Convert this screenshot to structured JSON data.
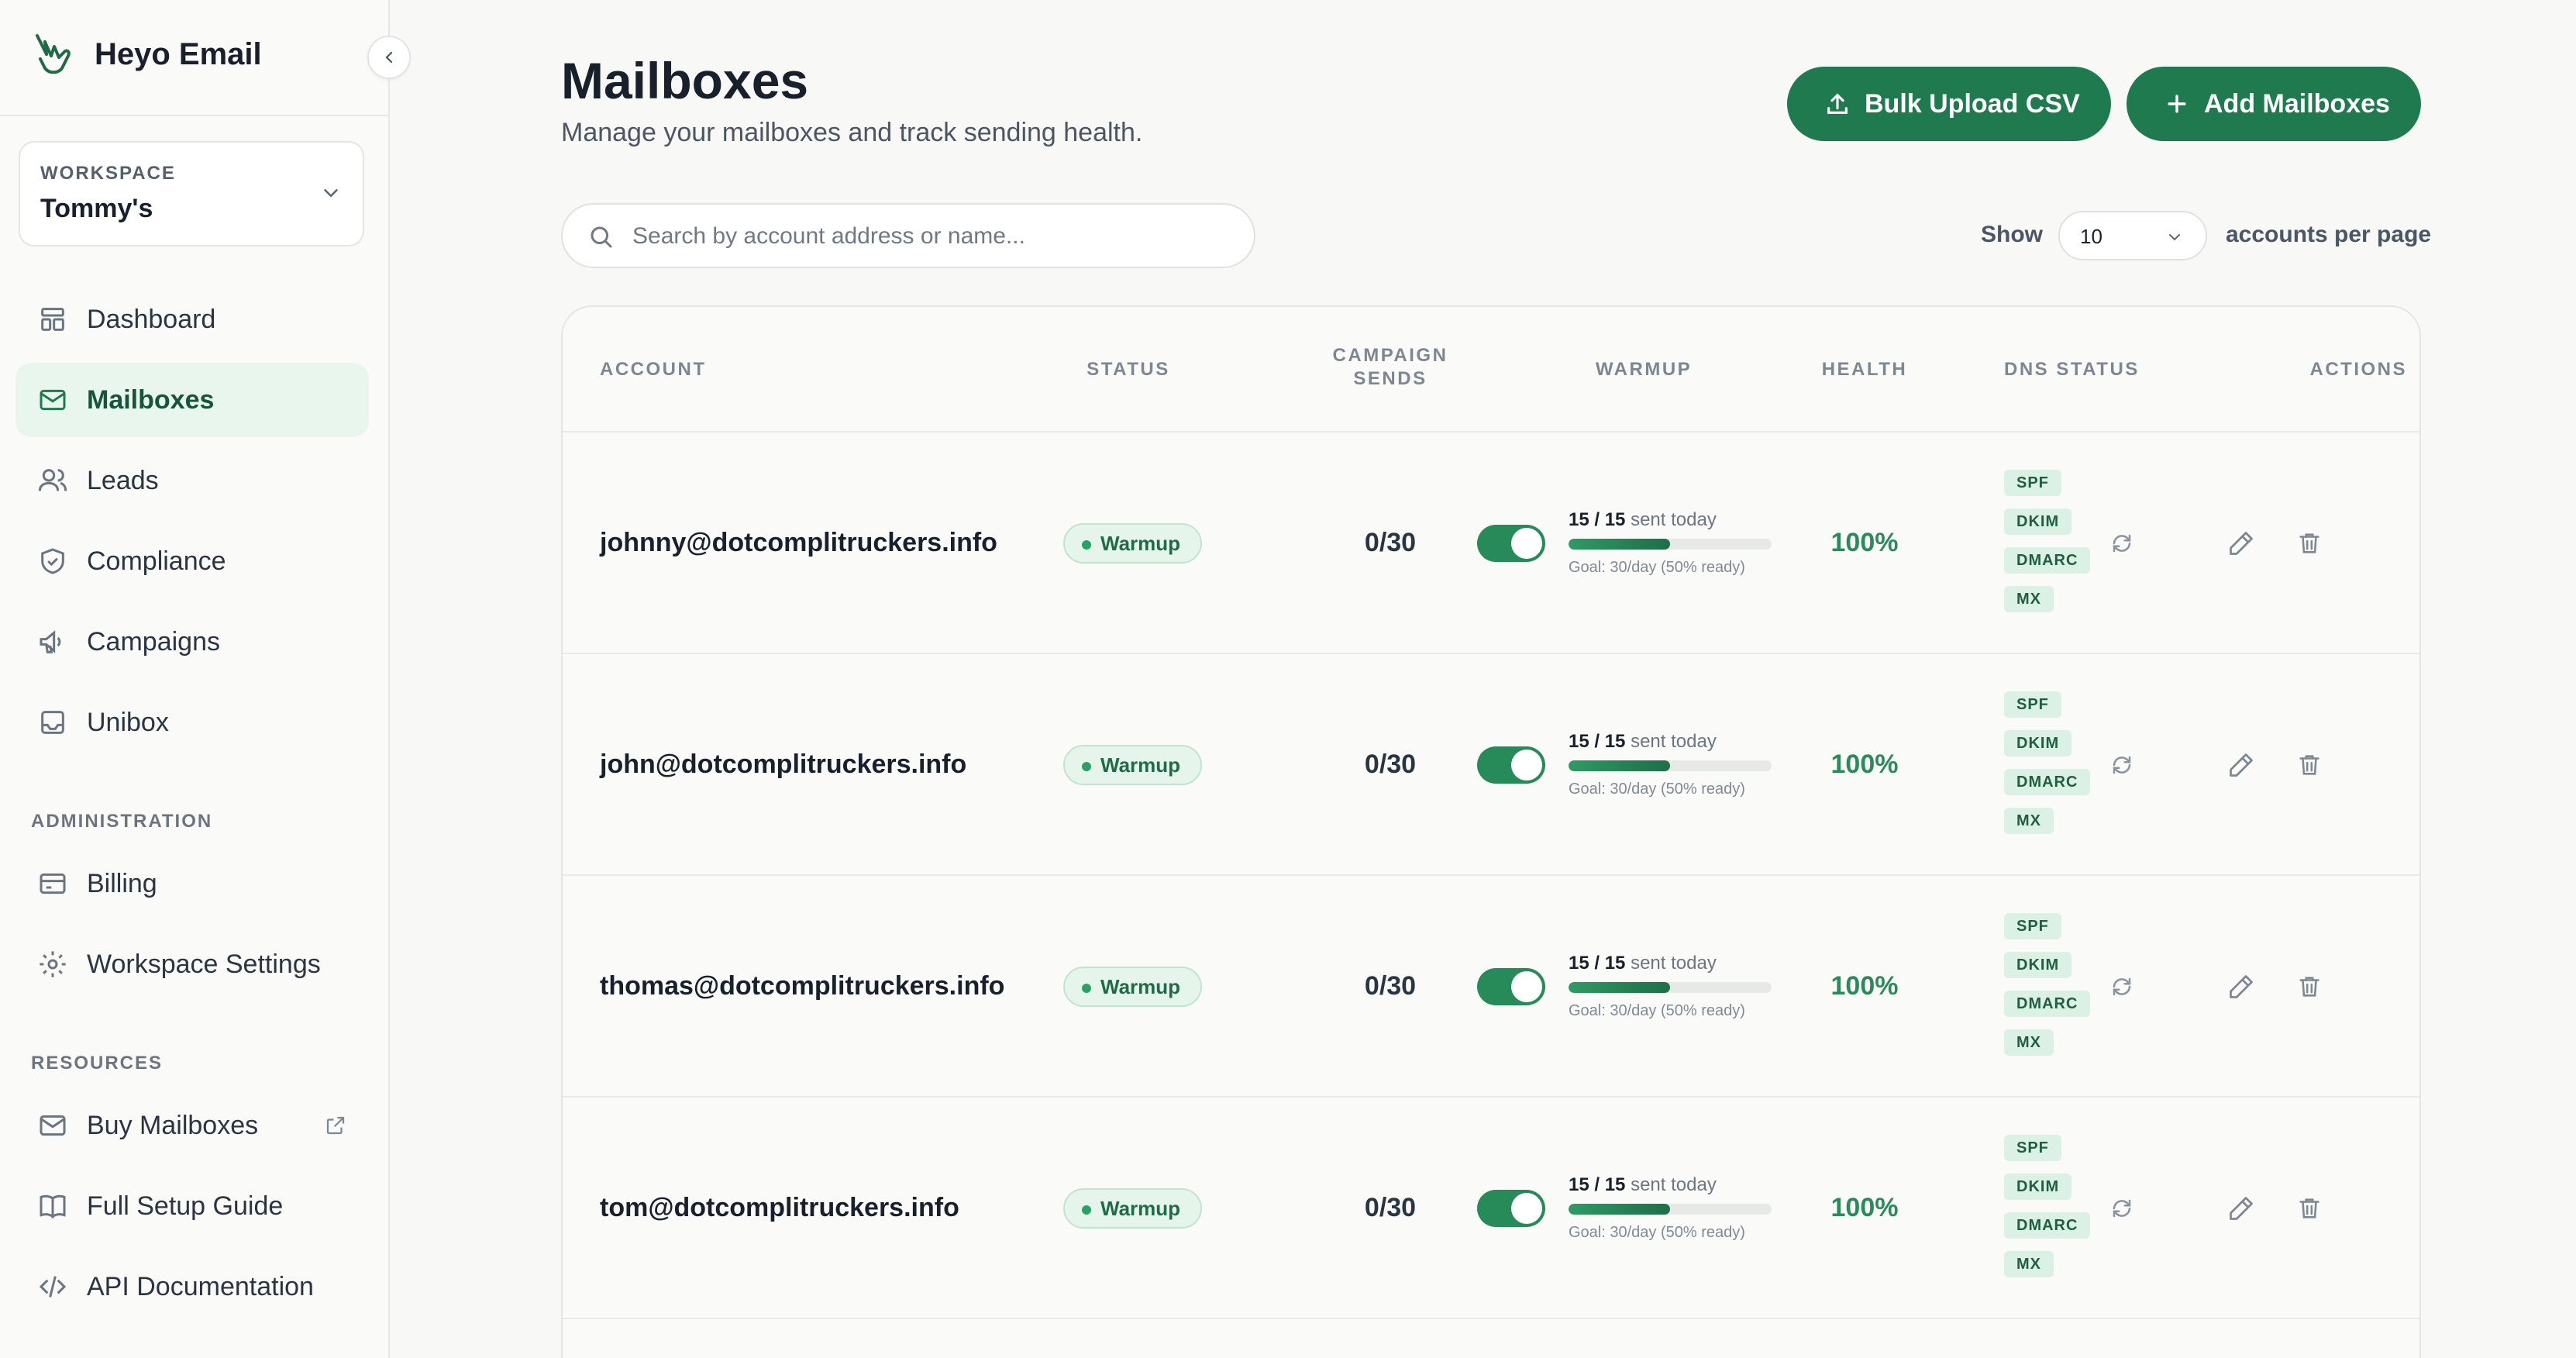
{
  "brand": {
    "name": "Heyo Email"
  },
  "workspace": {
    "label": "WORKSPACE",
    "value": "Tommy's"
  },
  "nav": {
    "main": [
      {
        "label": "Dashboard",
        "icon": "dashboard-icon",
        "active": false
      },
      {
        "label": "Mailboxes",
        "icon": "mail-icon",
        "active": true
      },
      {
        "label": "Leads",
        "icon": "users-icon",
        "active": false
      },
      {
        "label": "Compliance",
        "icon": "shield-check-icon",
        "active": false
      },
      {
        "label": "Campaigns",
        "icon": "megaphone-icon",
        "active": false
      },
      {
        "label": "Unibox",
        "icon": "inbox-icon",
        "active": false
      }
    ],
    "admin_label": "ADMINISTRATION",
    "admin": [
      {
        "label": "Billing",
        "icon": "credit-card-icon"
      },
      {
        "label": "Workspace Settings",
        "icon": "gear-icon"
      }
    ],
    "resources_label": "RESOURCES",
    "resources": [
      {
        "label": "Buy Mailboxes",
        "icon": "mail-icon",
        "external": true
      },
      {
        "label": "Full Setup Guide",
        "icon": "book-icon"
      },
      {
        "label": "API Documentation",
        "icon": "code-icon"
      }
    ]
  },
  "header": {
    "title": "Mailboxes",
    "subtitle": "Manage your mailboxes and track sending health.",
    "bulk_upload_label": "Bulk Upload CSV",
    "add_label": "Add Mailboxes"
  },
  "search": {
    "placeholder": "Search by account address or name..."
  },
  "pagination": {
    "show_label": "Show",
    "per_page": "10",
    "suffix": "accounts per page"
  },
  "table": {
    "columns": {
      "account": "ACCOUNT",
      "status": "STATUS",
      "campaign_sends_1": "CAMPAIGN",
      "campaign_sends_2": "SENDS",
      "warmup": "WARMUP",
      "health": "HEALTH",
      "dns": "DNS STATUS",
      "actions": "ACTIONS"
    },
    "rows": [
      {
        "account": "johnny@dotcomplitruckers.info",
        "status": "Warmup",
        "sends": "0/30",
        "warmup_enabled": true,
        "warmup_sent": "15 / 15",
        "warmup_suffix": "sent today",
        "warmup_progress": 0.5,
        "warmup_goal": "Goal: 30/day (50% ready)",
        "health": "100%",
        "dns": [
          "SPF",
          "DKIM",
          "DMARC",
          "MX"
        ]
      },
      {
        "account": "john@dotcomplitruckers.info",
        "status": "Warmup",
        "sends": "0/30",
        "warmup_enabled": true,
        "warmup_sent": "15 / 15",
        "warmup_suffix": "sent today",
        "warmup_progress": 0.5,
        "warmup_goal": "Goal: 30/day (50% ready)",
        "health": "100%",
        "dns": [
          "SPF",
          "DKIM",
          "DMARC",
          "MX"
        ]
      },
      {
        "account": "thomas@dotcomplitruckers.info",
        "status": "Warmup",
        "sends": "0/30",
        "warmup_enabled": true,
        "warmup_sent": "15 / 15",
        "warmup_suffix": "sent today",
        "warmup_progress": 0.5,
        "warmup_goal": "Goal: 30/day (50% ready)",
        "health": "100%",
        "dns": [
          "SPF",
          "DKIM",
          "DMARC",
          "MX"
        ]
      },
      {
        "account": "tom@dotcomplitruckers.info",
        "status": "Warmup",
        "sends": "0/30",
        "warmup_enabled": true,
        "warmup_sent": "15 / 15",
        "warmup_suffix": "sent today",
        "warmup_progress": 0.5,
        "warmup_goal": "Goal: 30/day (50% ready)",
        "health": "100%",
        "dns": [
          "SPF",
          "DKIM",
          "DMARC",
          "MX"
        ]
      }
    ]
  },
  "colors": {
    "accent": "#1f7a4f",
    "active_nav_bg": "#e9f6ee",
    "health_green": "#2a8a5a"
  }
}
